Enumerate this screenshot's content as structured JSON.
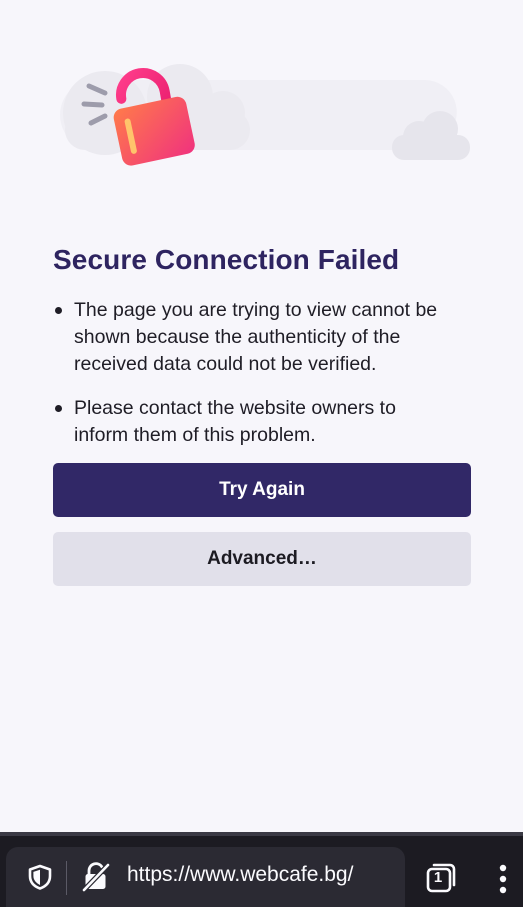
{
  "error": {
    "title": "Secure Connection Failed",
    "bullets": [
      "The page you are trying to view cannot be shown because the authenticity of the received data could not be verified.",
      "Please contact the website owners to inform them of this problem."
    ],
    "try_again_label": "Try Again",
    "advanced_label": "Advanced…"
  },
  "toolbar": {
    "url": "https://www.webcafe.bg/",
    "tab_count": "1"
  },
  "icons": {
    "illustration": "broken-lock-clouds-illustration",
    "shield": "shield-icon",
    "connection": "insecure-lock-icon",
    "tabs": "tabs-counter-icon",
    "menu": "kebab-menu-icon"
  },
  "colors": {
    "title": "#2e2460",
    "primary_button": "#312867",
    "secondary_button": "#e1e0ea",
    "toolbar": "#1c1b22",
    "url_bar": "#2b2a33",
    "lock_gradient_start": "#f4357a",
    "lock_gradient_end": "#ff7b4a"
  }
}
